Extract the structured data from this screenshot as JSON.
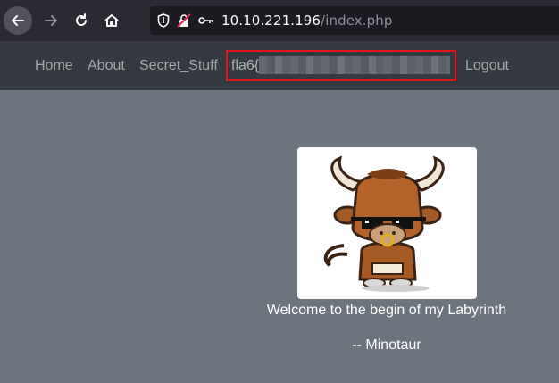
{
  "browser": {
    "url_host": "10.10.221.196",
    "url_path": "/index.php",
    "icons": [
      "back-arrow-icon",
      "forward-arrow-icon",
      "reload-icon",
      "home-icon",
      "shield-icon",
      "insecure-lock-icon",
      "key-icon"
    ]
  },
  "navbar": {
    "links": [
      "Home",
      "About",
      "Secret_Stuff"
    ],
    "flag_prefix": "fla6{",
    "logout": "Logout",
    "highlight_color": "#e0171b"
  },
  "main": {
    "image_label": "minotaur-cartoon",
    "welcome": "Welcome to the begin of my Labyrinth",
    "signature": "-- Minotaur"
  },
  "colors": {
    "page_bg": "#6c757d",
    "navbar_bg": "#343a40",
    "browser_bg": "#2b2a33"
  }
}
